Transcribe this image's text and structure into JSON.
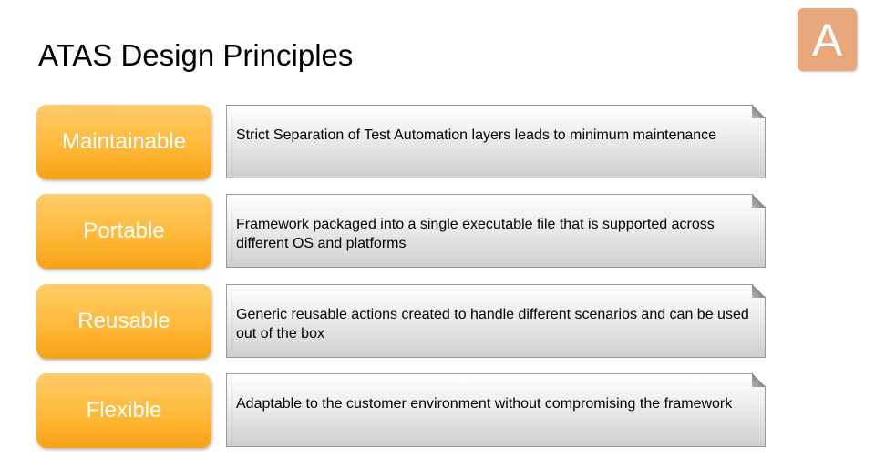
{
  "slide": {
    "title": "ATAS Design Principles",
    "logo_letter": "A",
    "colors": {
      "logo_bg": "#e9a87c",
      "pill_top": "#fecd6b",
      "pill_bottom": "#f8a214",
      "box_top": "#ffffff",
      "box_bottom": "#cfcfcf"
    }
  },
  "principles": [
    {
      "label": "Maintainable",
      "description": "Strict Separation of Test Automation layers leads to minimum maintenance"
    },
    {
      "label": "Portable",
      "description": "Framework packaged into a single executable file that is supported across different OS and platforms"
    },
    {
      "label": "Reusable",
      "description": "Generic reusable actions created to handle different scenarios and can be used out of the box"
    },
    {
      "label": "Flexible",
      "description": "Adaptable to the customer environment without compromising the framework"
    }
  ]
}
